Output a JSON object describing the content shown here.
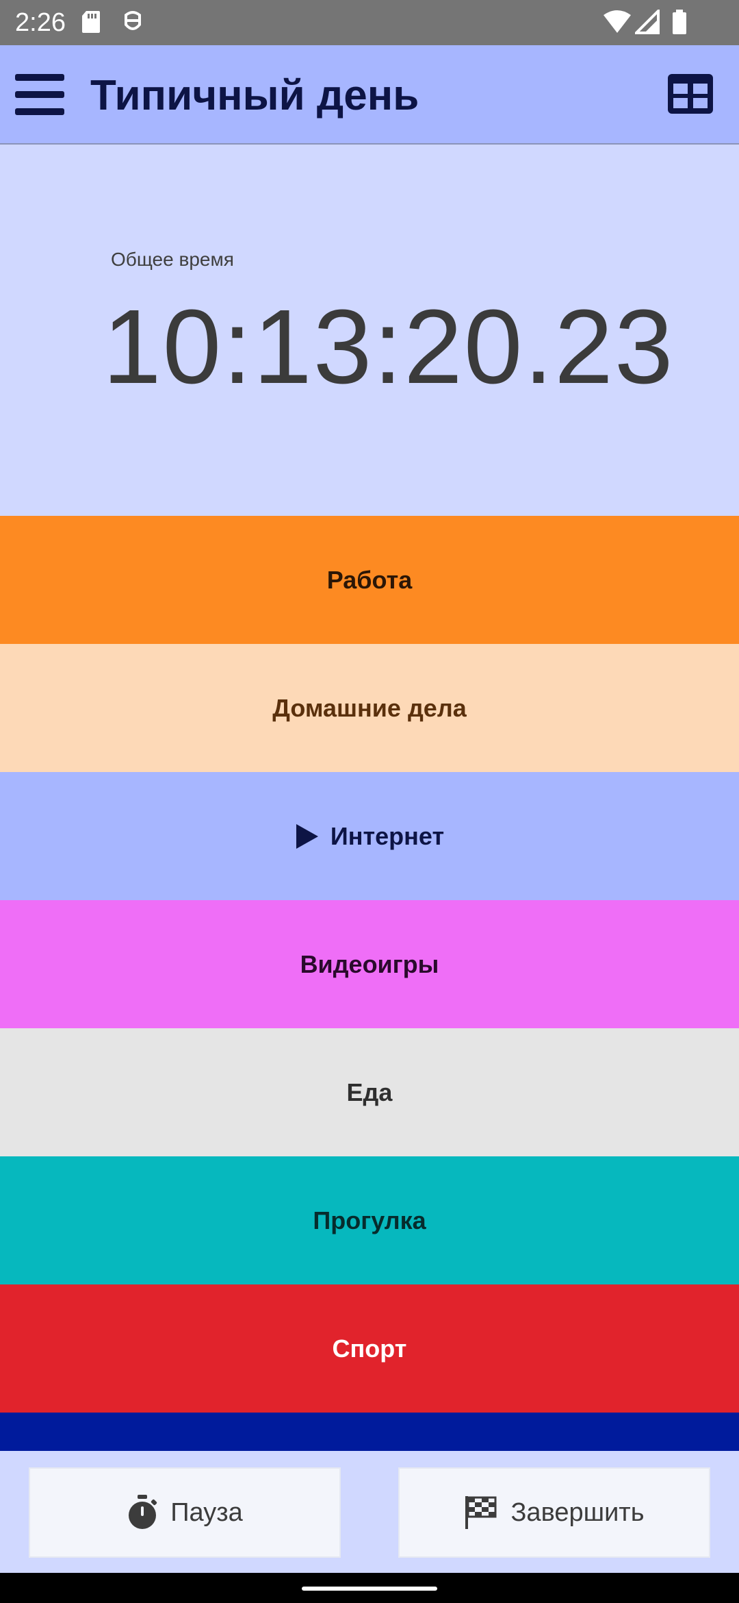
{
  "status_bar": {
    "time": "2:26"
  },
  "app_bar": {
    "title": "Типичный день"
  },
  "timer": {
    "label": "Общее время",
    "value": "10:13:20.23"
  },
  "activities": [
    {
      "label": "Работа",
      "bg": "#fd8a22",
      "fg": "#2b1606"
    },
    {
      "label": "Домашние дела",
      "bg": "#fdd9b7",
      "fg": "#5a300c"
    },
    {
      "label": "Интернет",
      "bg": "#a7b6ff",
      "fg": "#0d1445",
      "active": true
    },
    {
      "label": "Видеоигры",
      "bg": "#ef6ef7",
      "fg": "#2a0a2c"
    },
    {
      "label": "Еда",
      "bg": "#e5e5e5",
      "fg": "#2f2f2f"
    },
    {
      "label": "Прогулка",
      "bg": "#06b8be",
      "fg": "#062c2d"
    },
    {
      "label": "Спорт",
      "bg": "#e1232c",
      "fg": "#ffffff"
    }
  ],
  "partial_activity_color": "#001b9c",
  "buttons": {
    "pause_label": "Пауза",
    "finish_label": "Завершить"
  }
}
